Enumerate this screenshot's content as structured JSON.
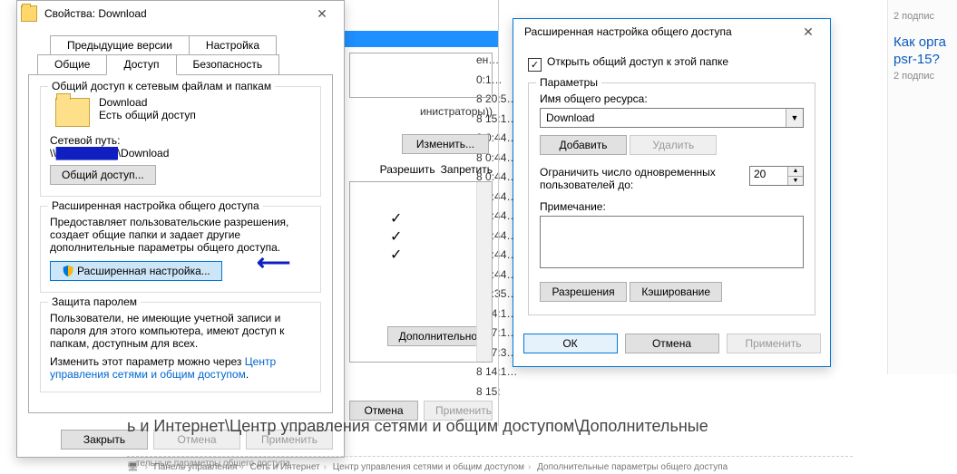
{
  "props": {
    "title": "Свойства: Download",
    "tabs_row1": [
      "Предыдущие версии",
      "Настройка"
    ],
    "tabs_row2": [
      "Общие",
      "Доступ",
      "Безопасность"
    ],
    "active_tab": "Доступ",
    "network_group_title": "Общий доступ к сетевым файлам и папкам",
    "folder_name": "Download",
    "share_status": "Есть общий доступ",
    "netpath_label": "Сетевой путь:",
    "netpath_value": "\\\\██████\\Download",
    "share_btn": "Общий доступ...",
    "adv_group_title": "Расширенная настройка общего доступа",
    "adv_desc": "Предоставляет пользовательские разрешения, создает общие папки и задает другие дополнительные параметры общего доступа.",
    "adv_btn": "Расширенная настройка...",
    "pwd_group_title": "Защита паролем",
    "pwd_desc": "Пользователи, не имеющие учетной записи и пароля для этого компьютера, имеют доступ к папкам, доступным для всех.",
    "pwd_change_prefix": "Изменить этот параметр можно через ",
    "pwd_link": "Центр управления сетями и общим доступом",
    "footer_close": "Закрыть",
    "footer_cancel": "Отмена",
    "footer_apply": "Применить"
  },
  "mid": {
    "group_text": "инистраторы)",
    "change_btn": "Изменить...",
    "col_allow": "Разрешить",
    "col_deny": "Запретить",
    "more_btn": "Дополнительно",
    "cancel_btn": "Отмена",
    "apply_btn": "Применить"
  },
  "timestamps": [
    "ен…",
    "0:1…",
    "8 20:5…",
    "8 15:1…",
    "8 0:44…",
    "8 0:44…",
    "8 0:44…",
    "8 0:44…",
    "8 0:44…",
    "8 0:44…",
    "8 0:44…",
    "8 0:44…",
    "8 0:35…",
    "8 14:1…",
    "8 17:1…",
    "8 17:3…",
    "8 14:1…",
    "8 15:"
  ],
  "adv": {
    "title": "Расширенная настройка общего доступа",
    "enable_label": "Открыть общий доступ к этой папке",
    "enable_checked": true,
    "params_title": "Параметры",
    "name_label": "Имя общего ресурса:",
    "name_value": "Download",
    "add_btn": "Добавить",
    "del_btn": "Удалить",
    "limit_label1": "Ограничить число одновременных",
    "limit_label2": "пользователей до:",
    "limit_value": "20",
    "note_label": "Примечание:",
    "perm_btn": "Разрешения",
    "cache_btn": "Кэширование",
    "ok": "ОК",
    "cancel": "Отмена",
    "apply": "Применить"
  },
  "sidebar": {
    "item1_sub": "2 подпис",
    "q_text": "Как орга\npsr-15?",
    "item2_sub": "2 подпис"
  },
  "pathline": "ь и Интернет\\Центр управления сетями и общим доступом\\Дополнительные",
  "crumbs": [
    "Панель управления",
    "Сеть и Интернет",
    "Центр управления сетями и общим доступом",
    "Дополнительные параметры общего доступа"
  ],
  "cutline_prefix": "…тельные параметры общего доступа"
}
